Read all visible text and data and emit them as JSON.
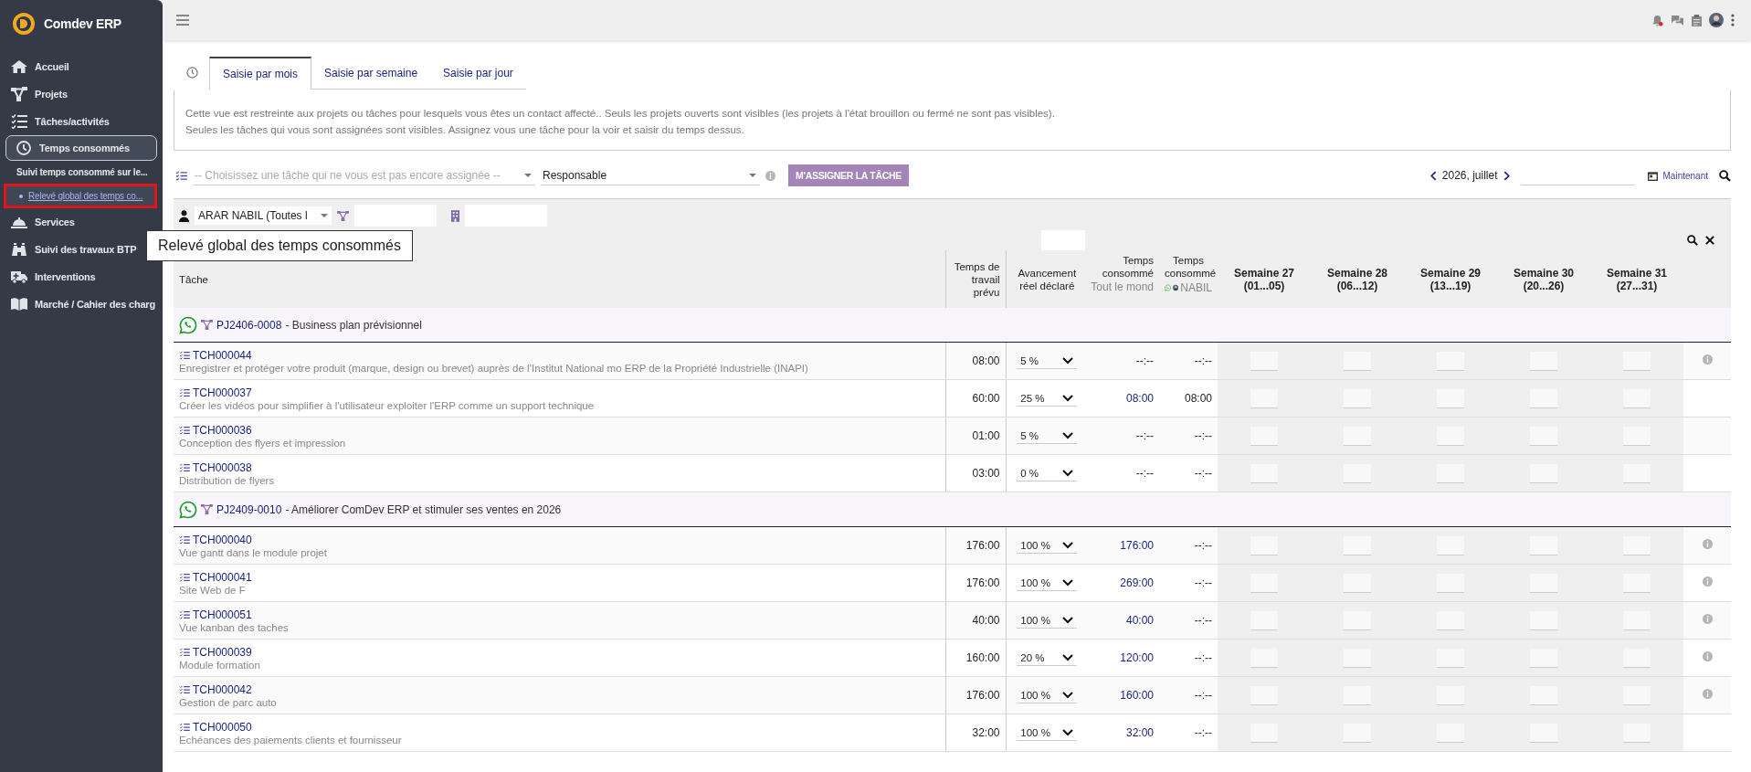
{
  "sidebar": {
    "brand": "Comdev ERP",
    "items": [
      {
        "label": "Accueil",
        "selected": false
      },
      {
        "label": "Projets",
        "selected": false
      },
      {
        "label": "Tâches/activités",
        "selected": false
      },
      {
        "label": "Temps consommés",
        "selected": true,
        "children": [
          {
            "label": "Suivi temps consommé sur le...",
            "selected": false
          },
          {
            "label": "Relevé global des temps co...",
            "selected": true
          }
        ]
      },
      {
        "label": "Services",
        "selected": false
      },
      {
        "label": "Suivi des travaux BTP",
        "selected": false
      },
      {
        "label": "Interventions",
        "selected": false
      },
      {
        "label": "Marché / Cahier des charg",
        "selected": false
      }
    ]
  },
  "topbar": {
    "notification_dot": true
  },
  "tabs": [
    {
      "label": "Saisie par mois",
      "selected": true
    },
    {
      "label": "Saisie par semaine",
      "selected": false
    },
    {
      "label": "Saisie par jour",
      "selected": false
    }
  ],
  "notice": [
    "Cette vue est restreinte aux projets ou tâches pour lesquels vous êtes un contact affecté.. Seuls les projets ouverts sont visibles (les projets à l'état brouillon ou fermé ne sont pas visibles).",
    "Seules les tâches qui vous sont assignées sont visibles. Assignez vous une tâche pour la voir et saisir du temps dessus."
  ],
  "assign": {
    "task_placeholder": "-- Choisissez une tâche qui ne vous est pas encore assignée --",
    "role": "Responsable",
    "button": "M'ASSIGNER LA TÂCHE"
  },
  "period": {
    "label": "2026, juillet",
    "now_link": "Maintenant"
  },
  "filters": {
    "user": "ARAR NABIL (Toutes l"
  },
  "tooltip": {
    "text": "Relevé global des temps consommés"
  },
  "columns": {
    "task": "Tâche",
    "planned": "Temps de travail prévu",
    "progress": "Avancement réel déclaré",
    "consumed_all": {
      "title": "Temps consommé",
      "who": "Tout le mond"
    },
    "consumed_me": {
      "title": "Temps consommé",
      "who": "NABIL"
    },
    "weeks": [
      {
        "title": "Semaine 27",
        "range": "(01...05)"
      },
      {
        "title": "Semaine 28",
        "range": "(06...12)"
      },
      {
        "title": "Semaine 29",
        "range": "(13...19)"
      },
      {
        "title": "Semaine 30",
        "range": "(20...26)"
      },
      {
        "title": "Semaine 31",
        "range": "(27...31)"
      }
    ]
  },
  "groups": [
    {
      "ref": "PJ2406-0008",
      "label": "- Business plan prévisionnel",
      "tasks": [
        {
          "ref": "TCH000044",
          "label": "Enregistrer et protéger votre produit (marque, design ou brevet) auprès de l’Institut National mo ERP de la Propriété Industrielle (INAPI)",
          "planned": "08:00",
          "progress": "5 %",
          "consumed_all": {
            "text": "--:--",
            "link": false
          },
          "consumed_me": "--:--",
          "info": true
        },
        {
          "ref": "TCH000037",
          "label": "Créer les vidéos pour simplifier à l'utilisateur exploiter l'ERP comme un support technique",
          "planned": "60:00",
          "progress": "25 %",
          "consumed_all": {
            "text": "08:00",
            "link": true
          },
          "consumed_me": "08:00",
          "info": false
        },
        {
          "ref": "TCH000036",
          "label": "Conception des flyers et impression",
          "planned": "01:00",
          "progress": "5 %",
          "consumed_all": {
            "text": "--:--",
            "link": false
          },
          "consumed_me": "--:--",
          "info": false
        },
        {
          "ref": "TCH000038",
          "label": "Distribution de flyers",
          "planned": "03:00",
          "progress": "0 %",
          "consumed_all": {
            "text": "--:--",
            "link": false
          },
          "consumed_me": "--:--",
          "info": false
        }
      ]
    },
    {
      "ref": "PJ2409-0010",
      "label": "- Améliorer ComDev ERP et stimuler ses ventes en 2026",
      "tasks": [
        {
          "ref": "TCH000040",
          "label": "Vue gantt dans le module projet",
          "planned": "176:00",
          "progress": "100 %",
          "consumed_all": {
            "text": "176:00",
            "link": true
          },
          "consumed_me": "--:--",
          "info": true
        },
        {
          "ref": "TCH000041",
          "label": "Site Web de F",
          "planned": "176:00",
          "progress": "100 %",
          "consumed_all": {
            "text": "269:00",
            "link": true
          },
          "consumed_me": "--:--",
          "info": true
        },
        {
          "ref": "TCH000051",
          "label": "Vue kanban des taches",
          "planned": "40:00",
          "progress": "100 %",
          "consumed_all": {
            "text": "40:00",
            "link": true
          },
          "consumed_me": "--:--",
          "info": true
        },
        {
          "ref": "TCH000039",
          "label": "Module formation",
          "planned": "160:00",
          "progress": "20 %",
          "consumed_all": {
            "text": "120:00",
            "link": true
          },
          "consumed_me": "--:--",
          "info": true
        },
        {
          "ref": "TCH000042",
          "label": "Gestion de parc auto",
          "planned": "176:00",
          "progress": "100 %",
          "consumed_all": {
            "text": "160:00",
            "link": true
          },
          "consumed_me": "--:--",
          "info": true
        },
        {
          "ref": "TCH000050",
          "label": "Echéances des paiements clients et fournisseur",
          "planned": "32:00",
          "progress": "100 %",
          "consumed_all": {
            "text": "32:00",
            "link": true
          },
          "consumed_me": "--:--",
          "info": false
        }
      ]
    }
  ]
}
